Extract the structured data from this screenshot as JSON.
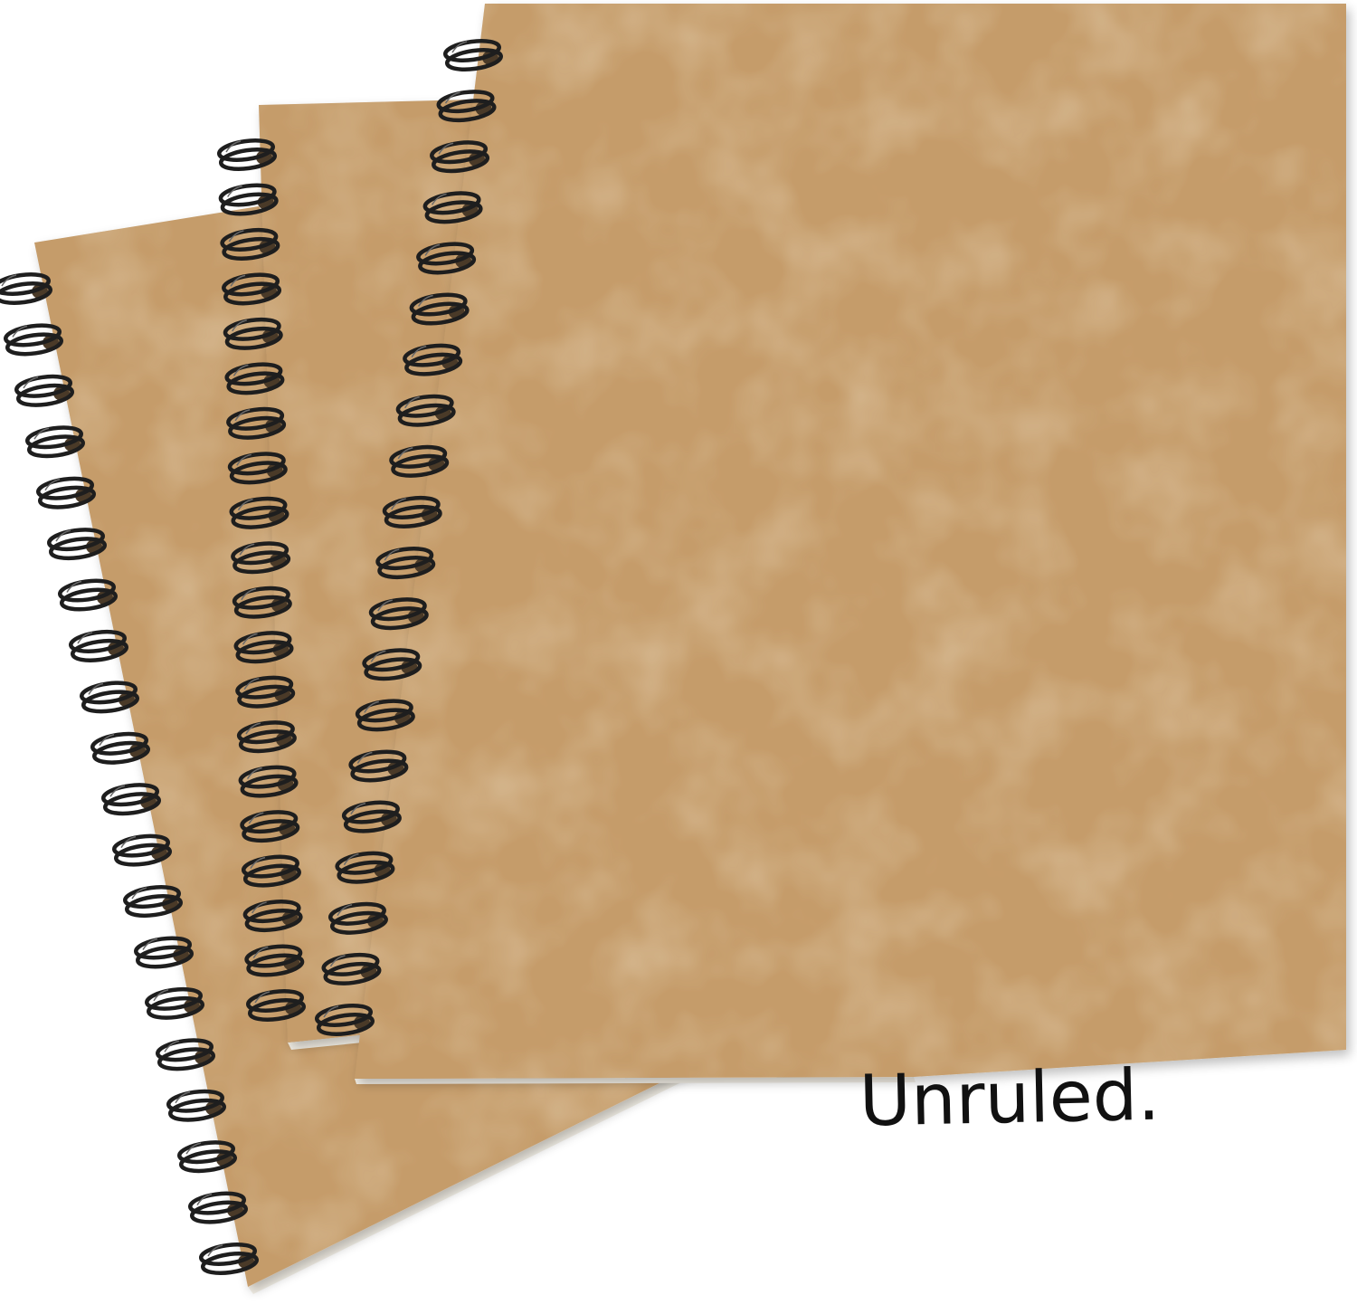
{
  "product": {
    "cover_text": "Unruled."
  },
  "notebooks": [
    {
      "id": "back",
      "coil_count": 20
    },
    {
      "id": "middle",
      "coil_count": 20
    },
    {
      "id": "front",
      "coil_count": 20
    }
  ],
  "colors": {
    "background": "#ffffff",
    "cover_base": "#c59c6b",
    "cover_light": "#d2ad7c",
    "cover_mottle": "#ae8552",
    "page_edge": "#f3efe6",
    "coil": "#1e1e1e",
    "coil_hole": "#4a3a28",
    "text": "#111111"
  }
}
